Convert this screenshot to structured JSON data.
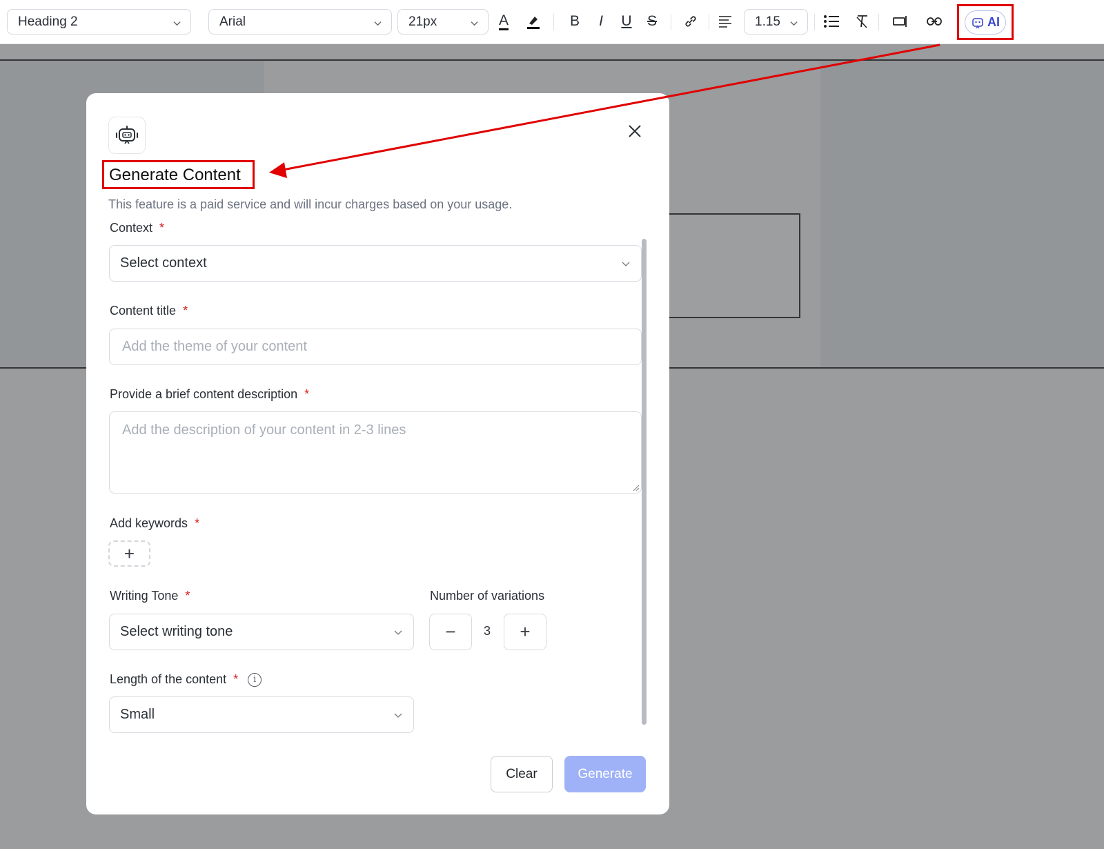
{
  "toolbar": {
    "block_style": "Heading 2",
    "font_family": "Arial",
    "font_size": "21px",
    "line_height": "1.15",
    "ai_label": "AI",
    "icons": [
      "text-color-icon",
      "highlight-icon",
      "bold-icon",
      "italic-icon",
      "underline-icon",
      "strikethrough-icon",
      "link-icon",
      "align-icon",
      "bullet-list-icon",
      "clear-format-icon",
      "insert-field-icon",
      "unlink-icon"
    ],
    "glyphs": {
      "text_color": "A",
      "bold": "B",
      "italic": "I",
      "underline": "U",
      "strike": "S"
    }
  },
  "modal": {
    "title": "Generate Content",
    "subtitle": "This feature is a paid service and will incur charges based on your usage.",
    "context": {
      "label": "Context",
      "value": "Select context"
    },
    "content_title": {
      "label": "Content title",
      "placeholder": "Add the theme of your content"
    },
    "description": {
      "label": "Provide a brief content description",
      "placeholder": "Add the description of your content in 2-3 lines"
    },
    "keywords": {
      "label": "Add keywords",
      "add": "+"
    },
    "tone": {
      "label": "Writing Tone",
      "value": "Select writing tone"
    },
    "variations": {
      "label": "Number of variations",
      "value": "3",
      "minus": "−",
      "plus": "+"
    },
    "length": {
      "label": "Length of the content",
      "value": "Small"
    },
    "required_mark": "*",
    "buttons": {
      "clear": "Clear",
      "generate": "Generate"
    }
  },
  "annotation": {
    "color": "#e00000"
  }
}
